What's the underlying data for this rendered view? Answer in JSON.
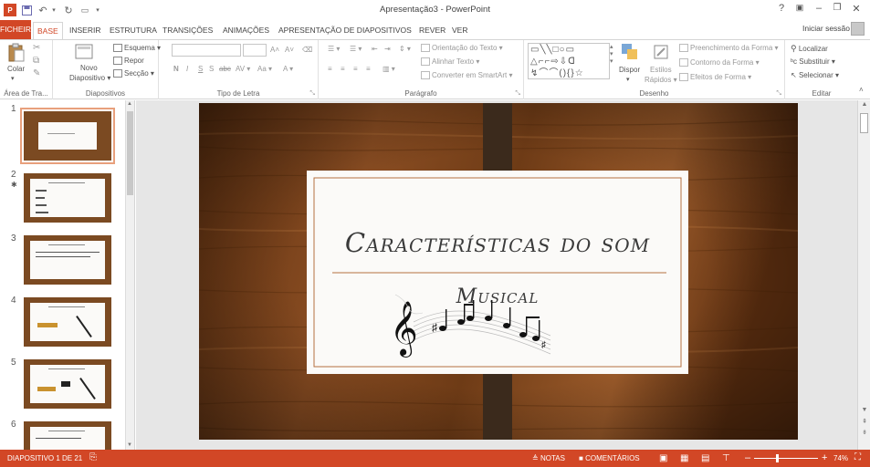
{
  "titlebar": {
    "title": "Apresentação3 - PowerPoint",
    "help": "?",
    "restore_icon": "ribbon-display-options-icon",
    "minimize": "–",
    "maximize": "❐",
    "close": "✕"
  },
  "tabs": [
    "FICHEIRO",
    "BASE",
    "INSERIR",
    "ESTRUTURA",
    "TRANSIÇÕES",
    "ANIMAÇÕES",
    "APRESENTAÇÃO DE DIAPOSITIVOS",
    "REVER",
    "VER"
  ],
  "signin": "Iniciar sessão",
  "ribbon": {
    "clipboard": {
      "paste": "Colar",
      "label": "Área de Tra..."
    },
    "slides": {
      "new_slide_1": "Novo",
      "new_slide_2": "Diapositivo ▾",
      "layout": "Esquema ▾",
      "reset": "Repor",
      "section": "Secção ▾",
      "label": "Diapositivos"
    },
    "font": {
      "label": "Tipo de Letra",
      "bold": "N",
      "italic": "I",
      "underline": "S",
      "shadow": "S",
      "strike": "abc",
      "spacing": "AV ▾",
      "case": "Aa ▾",
      "grow": "A˄",
      "shrink": "A˅",
      "color": "A ▾"
    },
    "paragraph": {
      "text_direction": "Orientação do Texto ▾",
      "align_text": "Alinhar Texto ▾",
      "smartart": "Converter em SmartArt ▾",
      "label": "Parágrafo"
    },
    "drawing": {
      "arrange": "Dispor",
      "styles_1": "Estilos",
      "styles_2": "Rápidos ▾",
      "fill": "Preenchimento da Forma ▾",
      "outline": "Contorno da Forma ▾",
      "effects": "Efeitos de Forma ▾",
      "label": "Desenho"
    },
    "editing": {
      "find": "Localizar",
      "replace": "Substituir ▾",
      "select": "Selecionar ▾",
      "label": "Editar"
    }
  },
  "thumbnails": [
    "1",
    "2",
    "3",
    "4",
    "5",
    "6"
  ],
  "slide": {
    "title_line1": "Características do som",
    "title_line2": "Musical"
  },
  "statusbar": {
    "slide_info": "DIAPOSITIVO 1 DE 21",
    "notes": "NOTAS",
    "comments": "COMENTÁRIOS",
    "zoom": "74%"
  },
  "colors": {
    "accent": "#d24726",
    "wood": "#6e3b16",
    "border_brown": "#a0522d"
  }
}
